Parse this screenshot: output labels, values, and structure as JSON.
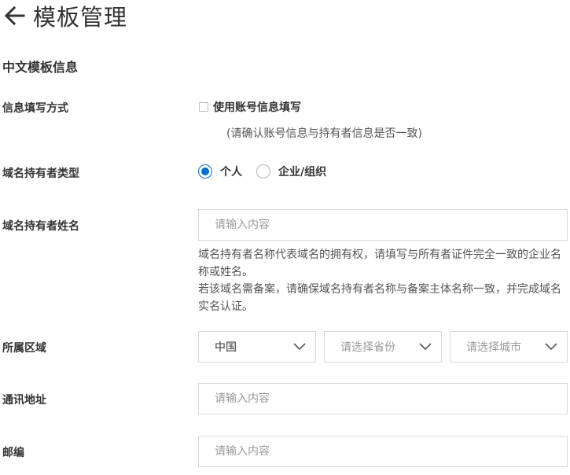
{
  "header": {
    "title": "模板管理"
  },
  "section": {
    "title": "中文模板信息"
  },
  "fill_method": {
    "label": "信息填写方式",
    "checkbox_label": "使用账号信息填写",
    "hint": "(请确认账号信息与持有者信息是否一致)",
    "checked": false
  },
  "holder_type": {
    "label": "域名持有者类型",
    "options": [
      {
        "label": "个人",
        "selected": true
      },
      {
        "label": "企业/组织",
        "selected": false
      }
    ]
  },
  "holder_name": {
    "label": "域名持有者姓名",
    "value": "",
    "placeholder": "请输入内容",
    "help": [
      "域名持有者名称代表域名的拥有权，请填写与所有者证件完全一致的企业名称或姓名。",
      "若该域名需备案，请确保域名持有者名称与备案主体名称一致，并完成域名实名认证。"
    ]
  },
  "region": {
    "label": "所属区域",
    "country": {
      "value": "中国"
    },
    "province": {
      "placeholder": "请选择省份"
    },
    "city": {
      "placeholder": "请选择城市"
    }
  },
  "address": {
    "label": "通讯地址",
    "value": "",
    "placeholder": "请输入内容"
  },
  "postcode": {
    "label": "邮编",
    "value": "",
    "placeholder": "请输入内容"
  },
  "colors": {
    "accent": "#0070cc",
    "border": "#d9d9d9",
    "placeholder": "#999999"
  }
}
